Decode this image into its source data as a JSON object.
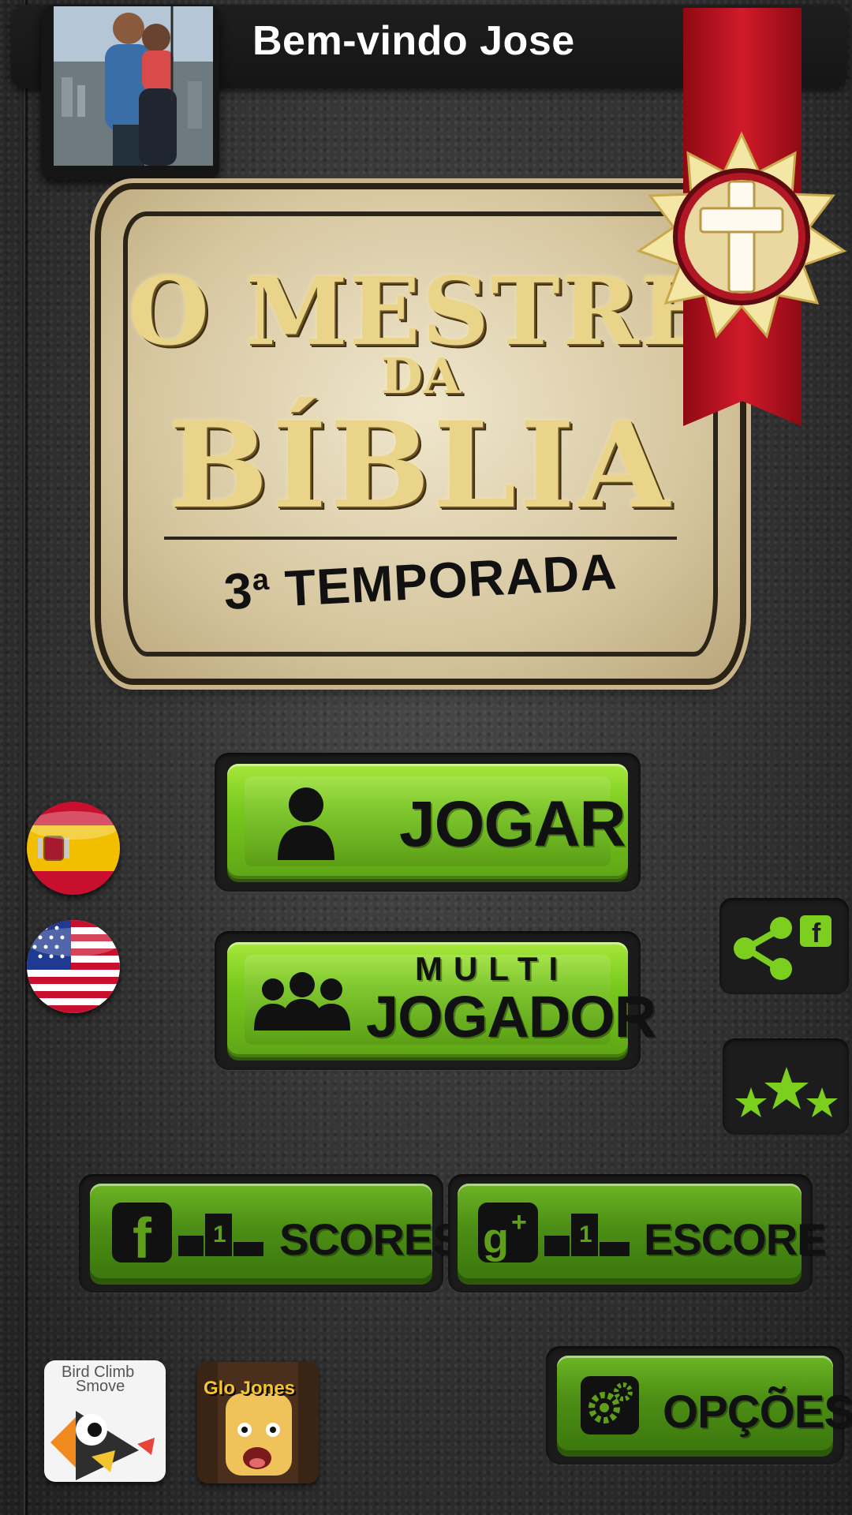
{
  "header": {
    "welcome_text": "Bem-vindo Jose"
  },
  "logo": {
    "line1": "O MESTRE",
    "line2": "DA",
    "line3": "BÍBLIA",
    "season_number": "3",
    "season_suffix": "a",
    "season_word": "TEMPORADA"
  },
  "main_menu": {
    "play_label": "JOGAR",
    "multi_top": "MULTI",
    "multi_bottom": "JOGADOR"
  },
  "leaderboards": {
    "facebook_label": "SCORES",
    "google_label": "ESCORE",
    "rank": "1"
  },
  "side": {
    "share_badge": "f"
  },
  "bottom": {
    "options_label": "OPÇÕES",
    "app1_title_line1": "Bird Climb",
    "app1_title_line2": "Smove",
    "app2_title": "Glo Jones"
  },
  "colors": {
    "button_green": "#78c81e",
    "ribbon_red": "#d11a2a",
    "gold": "#e9d48a",
    "leather": "#353535"
  }
}
